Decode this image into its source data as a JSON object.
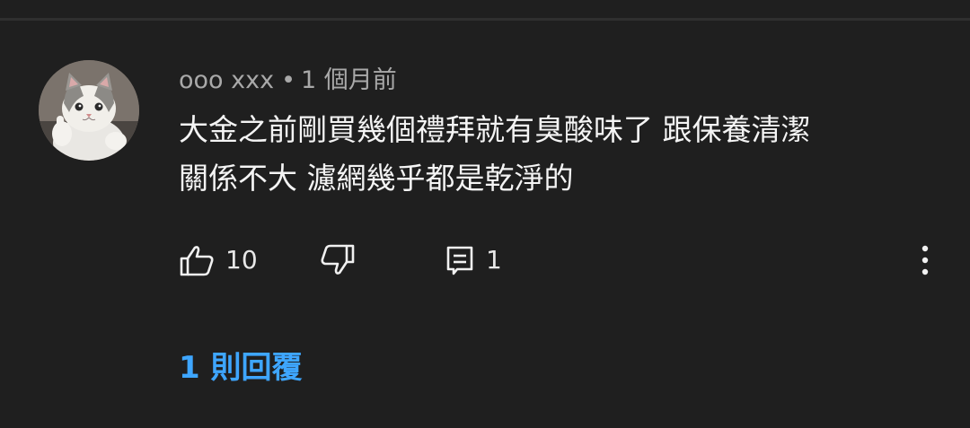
{
  "comment": {
    "author": "ooo xxx",
    "separator": "•",
    "time": "1 個月前",
    "lines": [
      "大金之前剛買幾個禮拜就有臭酸味了 跟保養清潔",
      "關係不大 濾網幾乎都是乾淨的"
    ],
    "avatar_icon": "cat-avatar"
  },
  "actions": {
    "like_icon": "thumb-up-icon",
    "like_count": "10",
    "dislike_icon": "thumb-down-icon",
    "reply_icon": "comment-icon",
    "reply_count": "1",
    "more_icon": "more-vert-icon"
  },
  "replies": {
    "label": "1 則回覆"
  },
  "colors": {
    "background": "#1f1f1f",
    "text": "#f4f4f4",
    "meta": "#a9a9a9",
    "link": "#3ea6ff"
  }
}
